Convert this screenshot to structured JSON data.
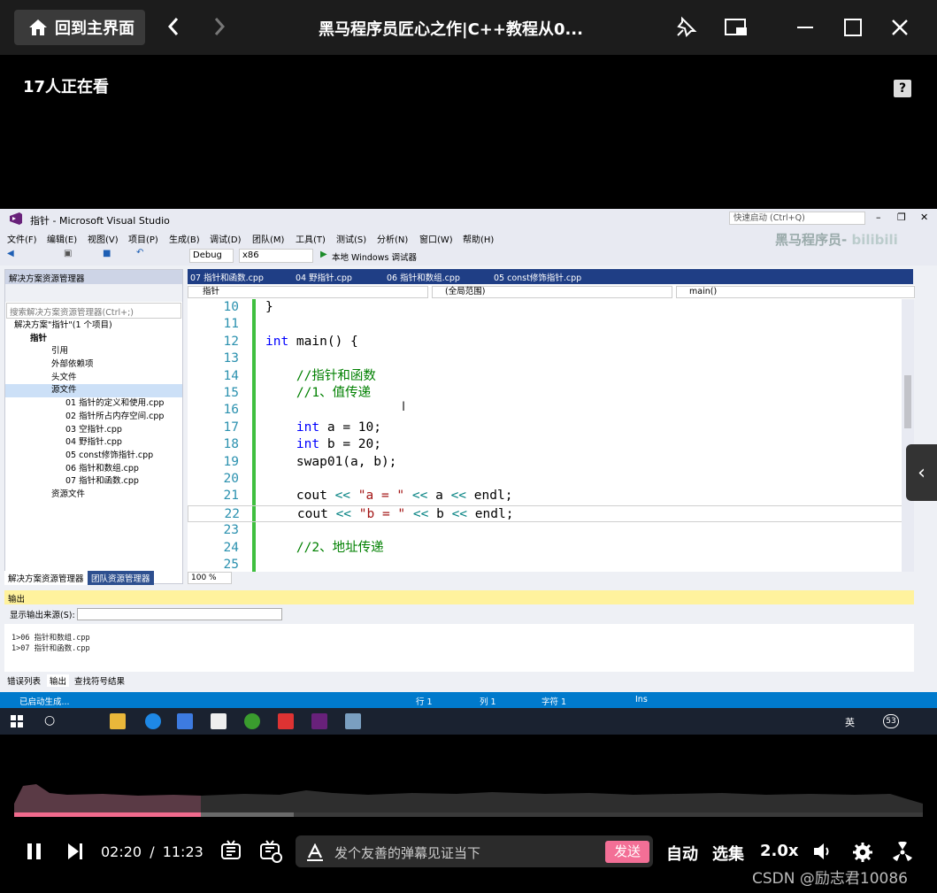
{
  "player": {
    "home_label": "回到主界面",
    "title": "黑马程序员匠心之作|C++教程从0...",
    "viewers": "17人正在看"
  },
  "vs": {
    "window_title": "指针 - Microsoft Visual Studio",
    "quick_launch": "快速启动 (Ctrl+Q)",
    "watermark": "黑马程序员-",
    "menu": [
      "文件(F)",
      "编辑(E)",
      "视图(V)",
      "项目(P)",
      "生成(B)",
      "调试(D)",
      "团队(M)",
      "工具(T)",
      "测试(S)",
      "分析(N)",
      "窗口(W)",
      "帮助(H)"
    ],
    "config": "Debug",
    "platform": "x86",
    "debugger": "本地 Windows 调试器",
    "solution_explorer": {
      "title": "解决方案资源管理器",
      "search": "搜索解决方案资源管理器(Ctrl+;)",
      "items": [
        "解决方案\"指针\"(1 个项目)",
        "指针",
        "引用",
        "外部依赖项",
        "头文件",
        "源文件",
        "01 指针的定义和使用.cpp",
        "02 指针所占内存空间.cpp",
        "03 空指针.cpp",
        "04 野指针.cpp",
        "05 const修饰指针.cpp",
        "06 指针和数组.cpp",
        "07 指针和函数.cpp",
        "资源文件"
      ],
      "tabs": [
        "解决方案资源管理器",
        "团队资源管理器"
      ]
    },
    "editor_tabs": [
      "07 指针和函数.cpp",
      "04 野指针.cpp",
      "06 指针和数组.cpp",
      "05 const修饰指针.cpp"
    ],
    "nav": {
      "project": "指针",
      "scope": "(全局范围)",
      "func": "main()"
    },
    "code_lines": [
      {
        "n": "10",
        "t": "}"
      },
      {
        "n": "11",
        "t": ""
      },
      {
        "n": "12",
        "t": "int main() {"
      },
      {
        "n": "13",
        "t": ""
      },
      {
        "n": "14",
        "t": "    //指针和函数"
      },
      {
        "n": "15",
        "t": "    //1、值传递"
      },
      {
        "n": "16",
        "t": ""
      },
      {
        "n": "17",
        "t": "    int a = 10;"
      },
      {
        "n": "18",
        "t": "    int b = 20;"
      },
      {
        "n": "19",
        "t": "    swap01(a, b);"
      },
      {
        "n": "20",
        "t": ""
      },
      {
        "n": "21",
        "t": "    cout << \"a = \" << a << endl;"
      },
      {
        "n": "22",
        "t": "    cout << \"b = \" << b << endl;"
      },
      {
        "n": "23",
        "t": ""
      },
      {
        "n": "24",
        "t": "    //2、地址传递"
      },
      {
        "n": "25",
        "t": ""
      }
    ],
    "zoom": "100 %",
    "output": {
      "title": "输出",
      "source_label": "显示输出来源(S):",
      "lines": [
        "1>06 指针和数组.cpp",
        "1>07 指针和函数.cpp"
      ],
      "tabs": [
        "错误列表",
        "输出",
        "查找符号结果"
      ]
    },
    "status": {
      "left": "已启动生成...",
      "row": "行 1",
      "col": "列 1",
      "char": "字符 1",
      "ins": "Ins"
    },
    "taskbar_ime": "英",
    "taskbar_badge": "53"
  },
  "controls": {
    "current_time": "02:20",
    "separator": "/",
    "duration": "11:23",
    "progress": 0.205,
    "buffered": 0.308,
    "danmaku_placeholder": "发个友善的弹幕见证当下",
    "send_label": "发送",
    "auto": "自动",
    "episodes": "选集",
    "speed": "2.0x"
  },
  "footer_watermark": "CSDN @励志君10086",
  "colors": {
    "accent": "#f36f96",
    "vs_blue": "#007acc"
  }
}
